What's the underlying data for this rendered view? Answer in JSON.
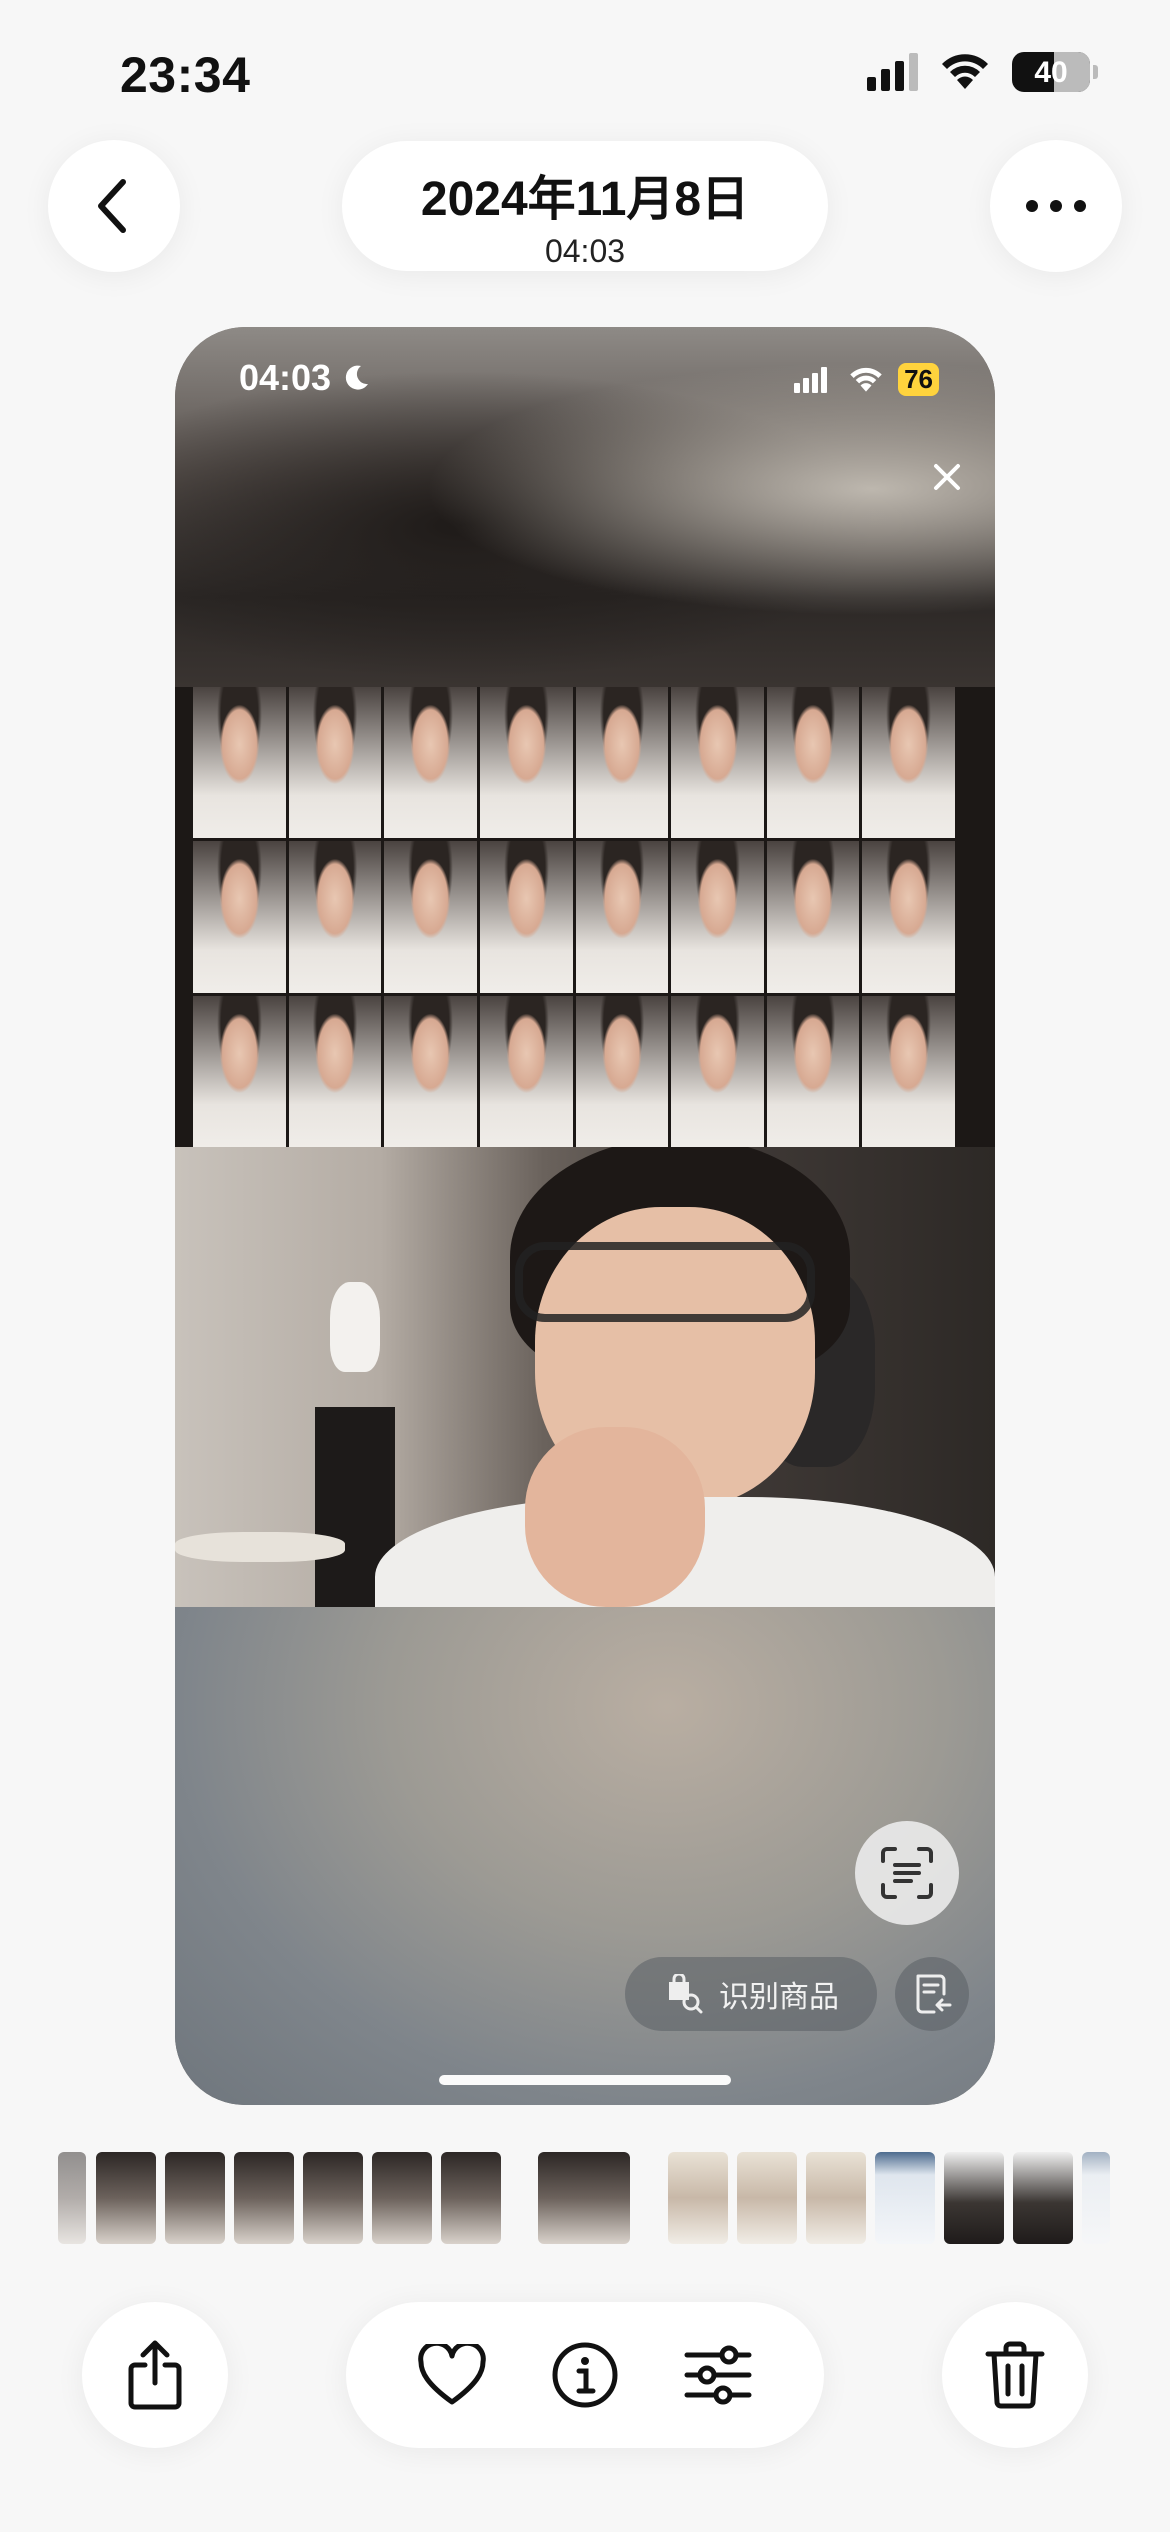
{
  "status_bar": {
    "time": "23:34",
    "battery": "40",
    "icons": [
      "cellular-signal-icon",
      "wifi-icon",
      "battery-icon"
    ]
  },
  "header": {
    "back_icon": "chevron-left-icon",
    "date": "2024年11月8日",
    "time": "04:03",
    "more_icon": "ellipsis-icon"
  },
  "photo": {
    "inner_status": {
      "time": "04:03",
      "battery": "76"
    },
    "recognize_label": "识别商品",
    "scan_icon": "live-text-scan-icon",
    "doc_icon": "document-lookup-icon"
  },
  "thumbnails": {
    "count": 17,
    "selected_index": 7
  },
  "toolbar": {
    "share_icon": "share-icon",
    "favorite_icon": "heart-icon",
    "info_icon": "info-icon",
    "adjust_icon": "sliders-icon",
    "delete_icon": "trash-icon"
  }
}
